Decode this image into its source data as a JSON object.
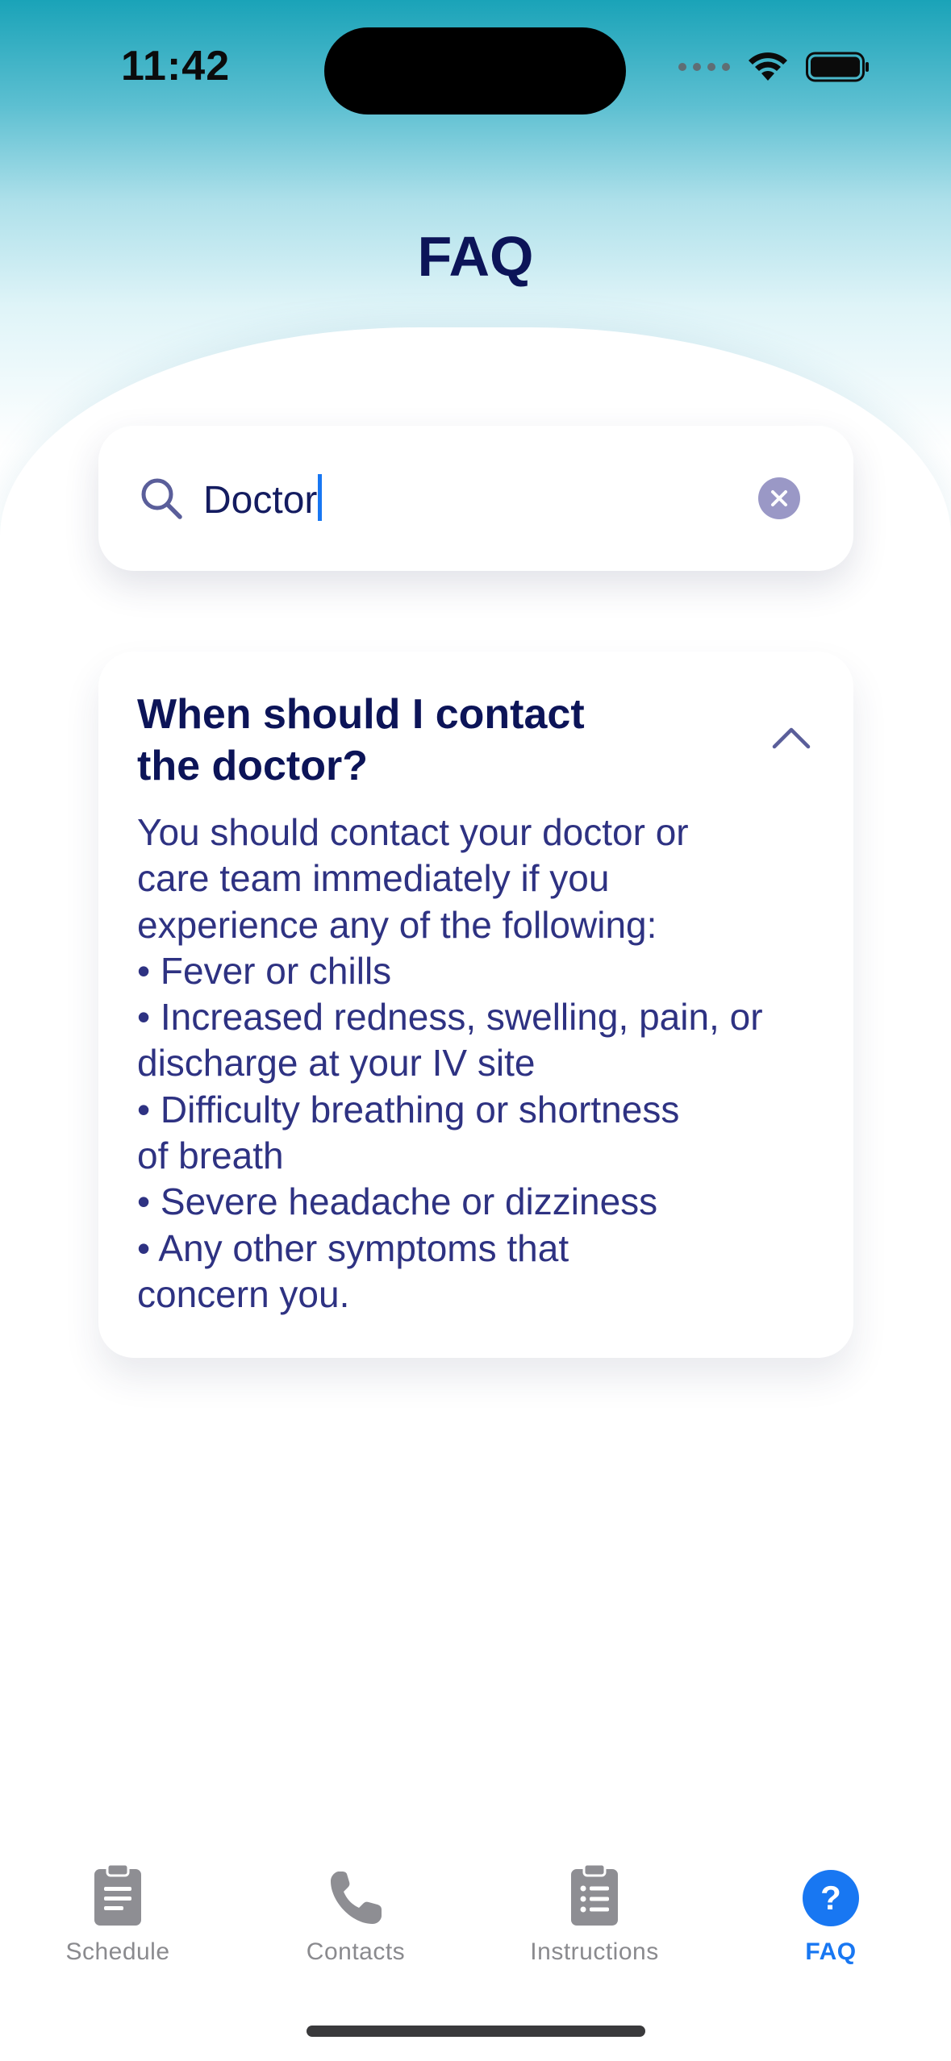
{
  "status_bar": {
    "time": "11:42"
  },
  "page": {
    "title": "FAQ"
  },
  "search": {
    "value": "Doctor",
    "placeholder": ""
  },
  "faq_items": [
    {
      "question": "When should I contact\nthe doctor?",
      "answer": "You should contact your doctor or\ncare team immediately if you\nexperience any of the following:\n• Fever or chills\n• Increased redness, swelling, pain, or\ndischarge at your IV site\n• Difficulty breathing or shortness\nof breath\n• Severe headache or dizziness\n• Any other symptoms that\nconcern you.",
      "expanded": true
    }
  ],
  "tab_bar": {
    "tabs": [
      {
        "label": "Schedule",
        "icon": "clipboard-icon"
      },
      {
        "label": "Contacts",
        "icon": "phone-icon"
      },
      {
        "label": "Instructions",
        "icon": "checklist-icon"
      },
      {
        "label": "FAQ",
        "icon": "question-circle-icon"
      }
    ],
    "active": "FAQ"
  },
  "colors": {
    "accent": "#1877f2",
    "title": "#0c1458",
    "body_text": "#2e3282",
    "inactive": "#8a8a8e"
  }
}
